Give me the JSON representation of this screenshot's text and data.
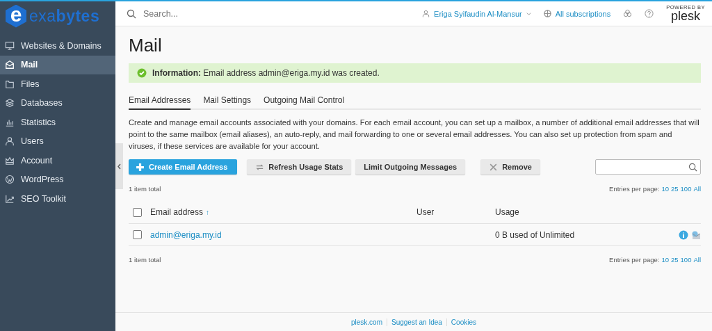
{
  "logo": {
    "mark": "e",
    "text_light": "exa",
    "text_bold": "bytes"
  },
  "sidebar": {
    "items": [
      {
        "label": "Websites & Domains",
        "selected": false
      },
      {
        "label": "Mail",
        "selected": true
      },
      {
        "label": "Files",
        "selected": false
      },
      {
        "label": "Databases",
        "selected": false
      },
      {
        "label": "Statistics",
        "selected": false
      },
      {
        "label": "Users",
        "selected": false
      },
      {
        "label": "Account",
        "selected": false
      },
      {
        "label": "WordPress",
        "selected": false
      },
      {
        "label": "SEO Toolkit",
        "selected": false
      }
    ]
  },
  "topbar": {
    "search": {
      "placeholder": "Search..."
    },
    "user": "Eriga Syifaudin Al-Mansur",
    "subscriptions": "All subscriptions",
    "powered_by": "POWERED BY",
    "brand": "plesk"
  },
  "page_title": "Mail",
  "message": {
    "text": "**Information:** Email address admin@eriga.my.id was created."
  },
  "tabs": [
    {
      "label": "Email Addresses",
      "selected": true
    },
    {
      "label": "Mail Settings",
      "selected": false
    },
    {
      "label": "Outgoing Mail Control",
      "selected": false
    }
  ],
  "description": "Create and manage email accounts associated with your domains. For each email account, you can set up a mailbox, a number of additional email addresses that will point to the same mailbox (email aliases), an auto-reply, and mail forwarding to one or several email addresses. You can also set up protection from spam and viruses, if these services are available for your account.",
  "toolbar": {
    "buttons": [
      {
        "label": "Create Email Address",
        "kind": "primary"
      },
      {
        "label": "Refresh Usage Stats",
        "kind": "refresh"
      },
      {
        "label": "Limit Outgoing Messages",
        "kind": "plain"
      },
      {
        "label": "Remove",
        "kind": "remove"
      }
    ]
  },
  "list": {
    "pager_top": {
      "total": "1 item total",
      "entries_label": "Entries per page:",
      "entries_options": [
        "10",
        "25",
        "100",
        "All"
      ]
    },
    "columns": [
      "Email address",
      "User",
      "Usage"
    ],
    "sort_mark": "↑",
    "rows": [
      {
        "email": "admin@eriga.my.id",
        "usage": "0 B used of Unlimited",
        "checked": false
      }
    ],
    "header_checked": false,
    "pager_bottom": {
      "total": "1 item total",
      "entries_label": "Entries per page:",
      "entries_options": [
        "10",
        "25",
        "100",
        "All"
      ]
    }
  },
  "footer": {
    "links": [
      "plesk.com",
      "Suggest an Idea",
      "Cookies"
    ]
  }
}
